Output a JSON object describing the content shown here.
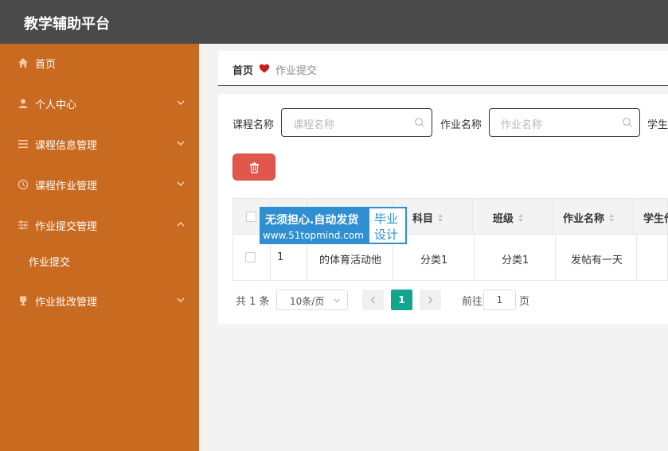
{
  "app": {
    "title": "教学辅助平台"
  },
  "sidebar": {
    "items": [
      {
        "label": "首页",
        "icon": "home-icon"
      },
      {
        "label": "个人中心",
        "icon": "user-icon"
      },
      {
        "label": "课程信息管理",
        "icon": "list-icon"
      },
      {
        "label": "课程作业管理",
        "icon": "clock-icon"
      },
      {
        "label": "作业提交管理",
        "icon": "sliders-icon"
      },
      {
        "label": "作业批改管理",
        "icon": "trophy-icon"
      }
    ],
    "subitem": {
      "label": "作业提交"
    }
  },
  "breadcrumb": {
    "home": "首页",
    "current": "作业提交"
  },
  "search": {
    "course_label": "课程名称",
    "course_placeholder": "课程名称",
    "homework_label": "作业名称",
    "homework_placeholder": "作业名称",
    "student_label": "学生"
  },
  "table": {
    "headers": [
      "科目",
      "班级",
      "作业名称",
      "学生作"
    ],
    "row": {
      "index": "1",
      "course": "的体育活动他",
      "subject": "分类1",
      "class": "分类1",
      "homework": "发帖有一天"
    }
  },
  "pagination": {
    "total": "共 1 条",
    "page_size": "10条/页",
    "current_page": "1",
    "goto_label": "前往",
    "goto_value": "1",
    "page_suffix": "页"
  },
  "watermark": {
    "line1": "无须担心.自动发货",
    "line2": "www.51topmind.com",
    "badge1": "毕业",
    "badge2": "设计"
  },
  "colors": {
    "sidebar": "#c96a21",
    "header": "#4a4a4a",
    "accent": "#13a68f",
    "danger": "#e0574b"
  }
}
